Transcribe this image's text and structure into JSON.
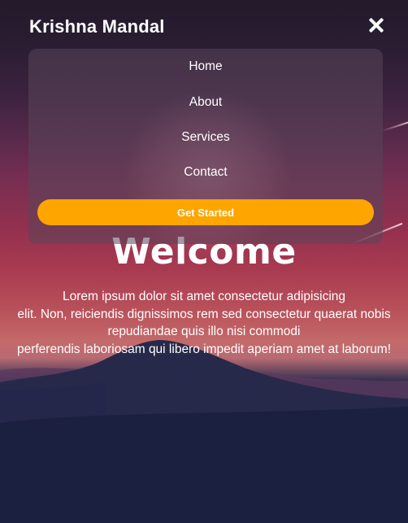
{
  "header": {
    "brand": "Krishna Mandal",
    "close_icon": "close-icon"
  },
  "menu": {
    "items": [
      {
        "label": "Home"
      },
      {
        "label": "About"
      },
      {
        "label": "Services"
      },
      {
        "label": "Contact"
      }
    ],
    "cta_label": "Get Started"
  },
  "hero": {
    "title": "Welcome",
    "lines": [
      "Lorem ipsum dolor sit amet consectetur adipisicing",
      "elit. Non, reiciendis dignissimos rem sed consectetur quaerat nobis",
      "repudiandae quis illo nisi commodi",
      "perferendis laboriosam qui libero impedit aperiam amet at laborum!"
    ]
  },
  "colors": {
    "accent": "#ffa500",
    "text": "#ffffff"
  }
}
